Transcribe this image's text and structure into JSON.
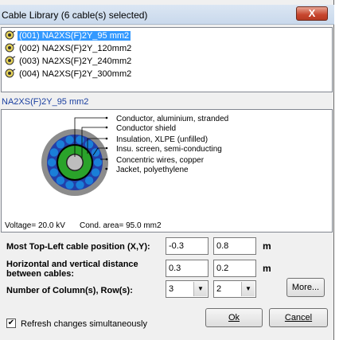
{
  "window": {
    "title": "Cable Library (6 cable(s) selected)",
    "close_label": "X"
  },
  "cable_list": {
    "items": [
      {
        "label": "(001) NA2XS(F)2Y_95 mm2",
        "selected": true
      },
      {
        "label": "(002) NA2XS(F)2Y_120mm2",
        "selected": false
      },
      {
        "label": "(003) NA2XS(F)2Y_240mm2",
        "selected": false
      },
      {
        "label": "(004) NA2XS(F)2Y_300mm2",
        "selected": false
      }
    ]
  },
  "selected_cable_name": "NA2XS(F)2Y_95 mm2",
  "cross_section": {
    "legend": [
      "Conductor, aluminium, stranded",
      "Conductor shield",
      "Insulation, XLPE (unfilled)",
      "Insu. screen, semi-conducting",
      "Concentric wires, copper",
      "Jacket, polyethylene"
    ],
    "voltage_text": "Voltage= 20.0 kV",
    "area_text": "Cond. area= 95.0 mm2",
    "colors": {
      "conductor": "#bdbdbd",
      "shield": "#222222",
      "insulation": "#2aa32a",
      "screen": "#000000",
      "wires": "#1a7fd8",
      "wire_bed": "#233fa8",
      "jacket": "#8c8c8c"
    }
  },
  "form": {
    "position_label": "Most Top-Left cable position (X,Y):",
    "position_x": "-0.3",
    "position_y": "0.8",
    "position_unit": "m",
    "distance_label": "Horizontal and vertical distance between cables:",
    "distance_h": "0.3",
    "distance_v": "0.2",
    "distance_unit": "m",
    "grid_label": "Number of Column(s), Row(s):",
    "columns": "3",
    "rows": "2",
    "more_button": "More..."
  },
  "footer": {
    "refresh_label": "Refresh changes simultaneously",
    "refresh_checked": true,
    "ok_label": "Ok",
    "cancel_label": "Cancel"
  }
}
